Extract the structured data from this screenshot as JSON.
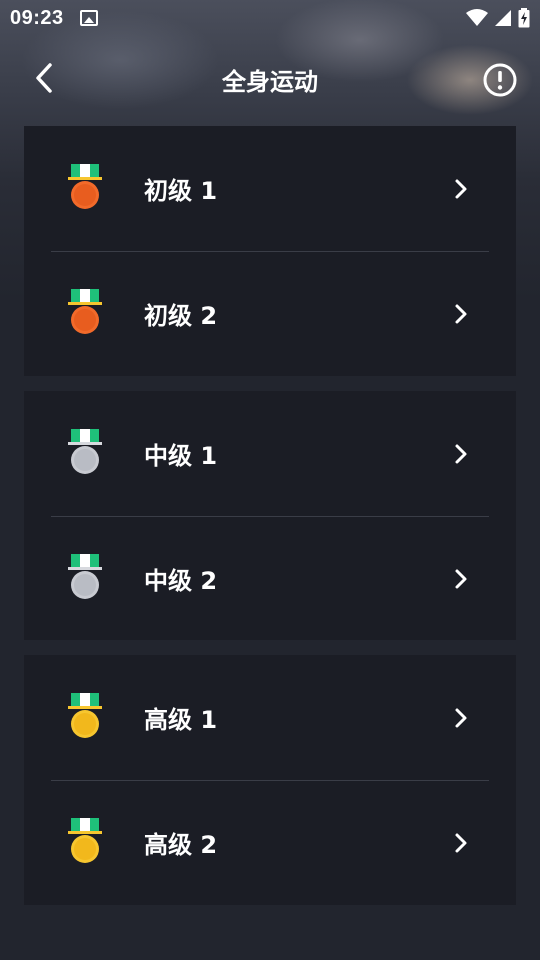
{
  "status_bar": {
    "time": "09:23",
    "icons": [
      "image-icon",
      "wifi-icon",
      "signal-icon",
      "battery-charging-icon"
    ]
  },
  "header": {
    "title": "全身运动",
    "back_icon": "chevron-left-icon",
    "info_icon": "info-circle-icon"
  },
  "groups": [
    {
      "medal": "bronze",
      "medal_color": "#f26a2a",
      "items": [
        {
          "label": "初级 1"
        },
        {
          "label": "初级 2"
        }
      ]
    },
    {
      "medal": "silver",
      "medal_color": "#c8cad1",
      "items": [
        {
          "label": "中级 1"
        },
        {
          "label": "中级 2"
        }
      ]
    },
    {
      "medal": "gold",
      "medal_color": "#f7c62f",
      "items": [
        {
          "label": "高级 1"
        },
        {
          "label": "高级 2"
        }
      ]
    }
  ],
  "colors": {
    "background": "#22252e",
    "card": "#1b1d25",
    "ribbon_green": "#1fc07a",
    "ribbon_white": "#ffffff"
  }
}
